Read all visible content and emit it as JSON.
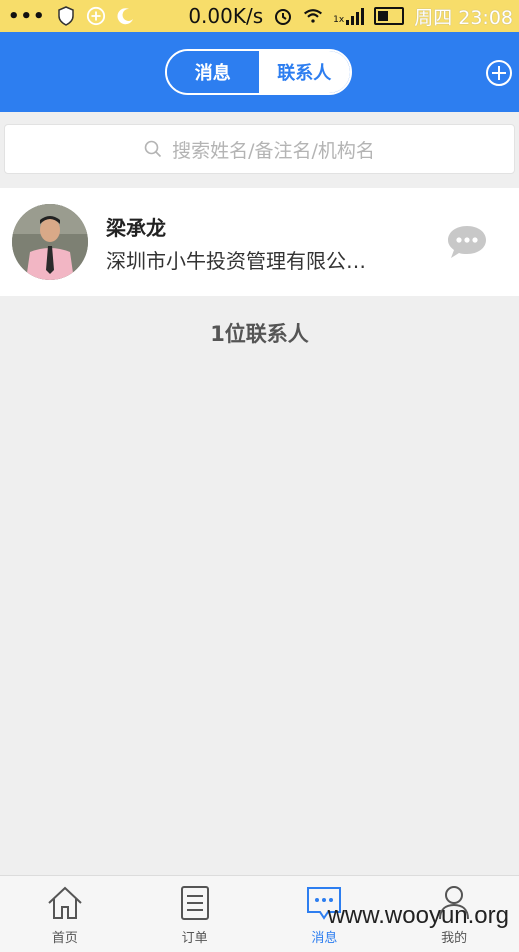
{
  "status_bar": {
    "dots": "•••",
    "speed": "0.00K/s",
    "signal_label": "1x",
    "time": "周四 23:08"
  },
  "header": {
    "tabs": [
      {
        "label": "消息",
        "active": false
      },
      {
        "label": "联系人",
        "active": true
      }
    ],
    "add_icon": "plus-circle-icon"
  },
  "search": {
    "placeholder": "搜索姓名/备注名/机构名"
  },
  "contacts": [
    {
      "name": "梁承龙",
      "organization": "深圳市小牛投资管理有限公…"
    }
  ],
  "contact_count_text": "1位联系人",
  "tabbar": {
    "items": [
      {
        "label": "首页",
        "icon": "home-icon",
        "active": false
      },
      {
        "label": "订单",
        "icon": "order-list-icon",
        "active": false
      },
      {
        "label": "消息",
        "icon": "message-icon",
        "active": true
      },
      {
        "label": "我的",
        "icon": "profile-icon",
        "active": false
      }
    ]
  },
  "watermark": "www.wooyun.org",
  "colors": {
    "accent": "#2d7ef0",
    "status_bar": "#f7dd6a",
    "background": "#efefef"
  }
}
